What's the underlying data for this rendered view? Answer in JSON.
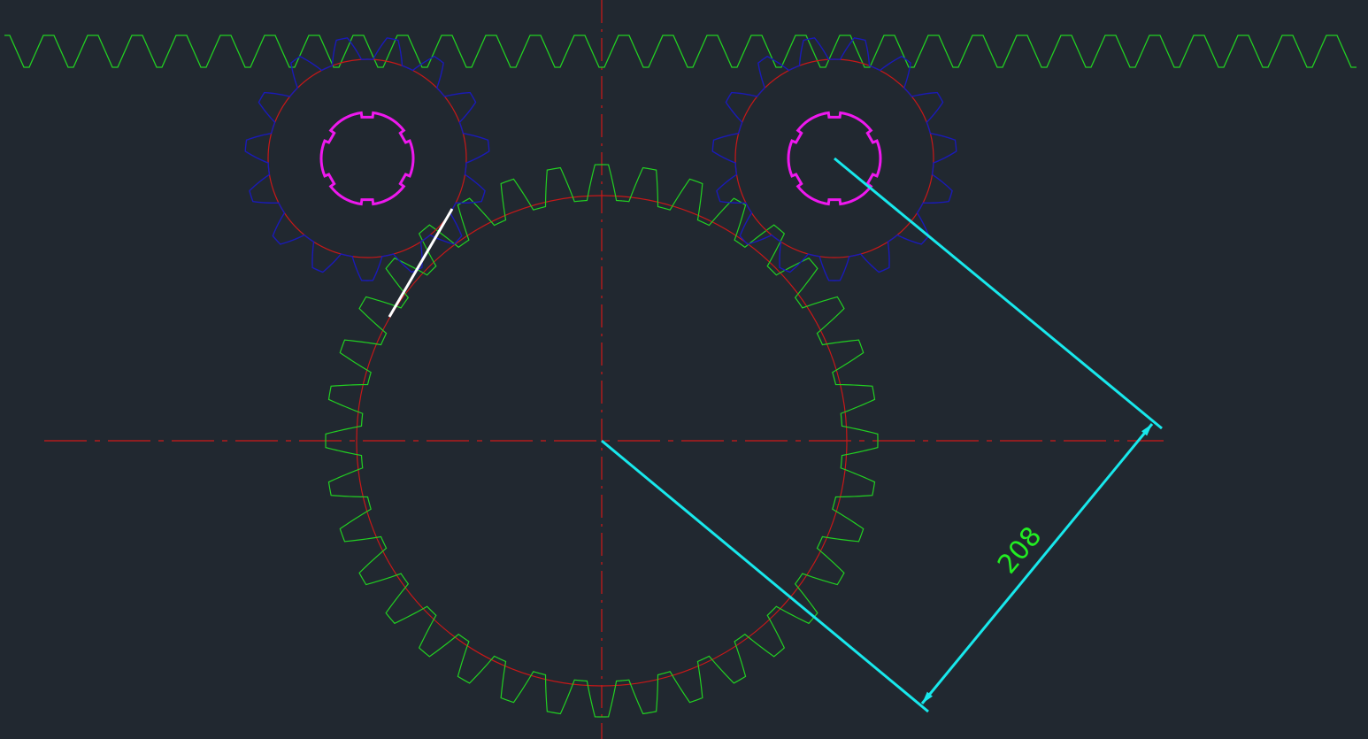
{
  "colors": {
    "background": "#212830",
    "centerline": "#d01818",
    "pitch_circle": "#c81818",
    "rack": "#22d022",
    "large_gear": "#22d022",
    "pinion": "#1a1ab8",
    "shaft_bore": "#ee18ee",
    "dimension": "#18e8ec",
    "dimension_text": "#22ee22",
    "highlight_line": "#ffffff"
  },
  "dimension": {
    "value_label": "208"
  }
}
